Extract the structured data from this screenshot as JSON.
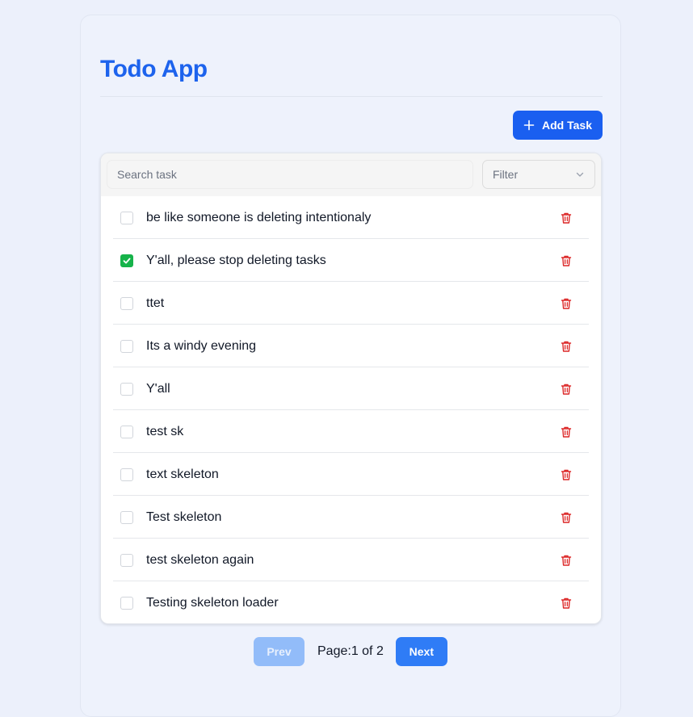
{
  "app": {
    "title": "Todo App"
  },
  "toolbar": {
    "add_label": "Add Task"
  },
  "search": {
    "placeholder": "Search task",
    "value": ""
  },
  "filter": {
    "label": "Filter"
  },
  "tasks": [
    {
      "text": "be like someone is deleting intentionaly",
      "done": false
    },
    {
      "text": "Y'all, please stop deleting tasks",
      "done": true
    },
    {
      "text": "ttet",
      "done": false
    },
    {
      "text": "Its a windy evening",
      "done": false
    },
    {
      "text": "Y'all",
      "done": false
    },
    {
      "text": "test sk",
      "done": false
    },
    {
      "text": "text skeleton",
      "done": false
    },
    {
      "text": "Test skeleton",
      "done": false
    },
    {
      "text": "test skeleton again",
      "done": false
    },
    {
      "text": "Testing skeleton loader",
      "done": false
    }
  ],
  "pagination": {
    "prev_label": "Prev",
    "next_label": "Next",
    "page_text": "Page:1 of 2",
    "current_page": 1,
    "total_pages": 2
  },
  "icons": {
    "add": "plus-icon",
    "filter": "chevron-down-icon",
    "delete": "trash-icon",
    "done": "check-icon"
  },
  "colors": {
    "brand": "#1d63ed",
    "primary_button": "#1a5ff0",
    "next_button": "#2f7cf6",
    "prev_button_disabled": "#92bcf9",
    "checked": "#16b34a",
    "delete": "#dc2626",
    "background": "#ecf0fb"
  }
}
